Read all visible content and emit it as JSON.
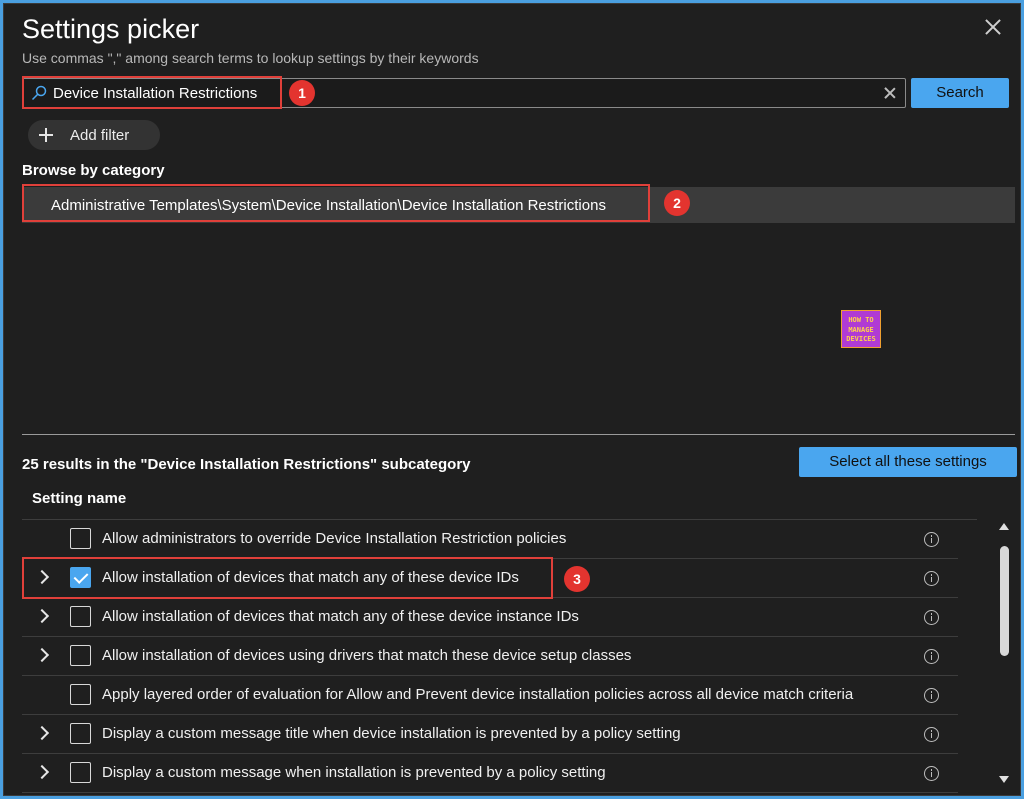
{
  "panel": {
    "title": "Settings picker",
    "subtitle": "Use commas \",\" among search terms to lookup settings by their keywords"
  },
  "search": {
    "value": "Device Installation Restrictions",
    "button_label": "Search"
  },
  "filter": {
    "add_label": "Add filter"
  },
  "browse": {
    "label": "Browse by category",
    "selected_path": "Administrative Templates\\System\\Device Installation\\Device Installation Restrictions"
  },
  "logo": {
    "line1": "HOW TO",
    "line2": "MANAGE",
    "line3": "DEVICES"
  },
  "results": {
    "summary": "25 results in the \"Device Installation Restrictions\" subcategory",
    "select_all_label": "Select all these settings",
    "column_header": "Setting name",
    "rows": [
      {
        "label": "Allow administrators to override Device Installation Restriction policies",
        "expandable": false,
        "checked": false
      },
      {
        "label": "Allow installation of devices that match any of these device IDs",
        "expandable": true,
        "checked": true
      },
      {
        "label": "Allow installation of devices that match any of these device instance IDs",
        "expandable": true,
        "checked": false
      },
      {
        "label": "Allow installation of devices using drivers that match these device setup classes",
        "expandable": true,
        "checked": false
      },
      {
        "label": "Apply layered order of evaluation for Allow and Prevent device installation policies across all device match criteria",
        "expandable": false,
        "checked": false
      },
      {
        "label": "Display a custom message title when device installation is prevented by a policy setting",
        "expandable": true,
        "checked": false
      },
      {
        "label": "Display a custom message when installation is prevented by a policy setting",
        "expandable": true,
        "checked": false
      }
    ]
  },
  "annotations": {
    "step1": "1",
    "step2": "2",
    "step3": "3"
  },
  "colors": {
    "accent": "#4aa6ef",
    "highlight_border": "#e0403a",
    "badge": "#e3342f",
    "panel_bg": "#1f1f1f"
  }
}
